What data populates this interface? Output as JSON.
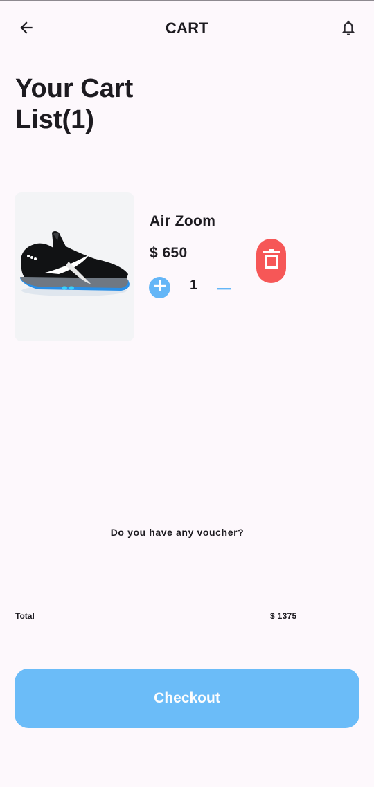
{
  "app_bar": {
    "title": "CART",
    "back_icon": "arrow-left-icon",
    "notification_icon": "bell-icon"
  },
  "page": {
    "title_line1": "Your Cart",
    "title_line2": "List(1)"
  },
  "cart": {
    "items": [
      {
        "name": "Air Zoom",
        "price": "$ 650",
        "quantity": "1",
        "image_icon": "sneaker-image",
        "add_icon": "plus-circle-icon",
        "remove_icon": "minus-icon",
        "delete_icon": "trash-icon"
      }
    ]
  },
  "voucher": {
    "label": "Do you have any voucher?"
  },
  "summary": {
    "total_label": "Total",
    "total_value": "$ 1375"
  },
  "checkout": {
    "label": "Checkout"
  },
  "colors": {
    "background": "#fdf8fc",
    "accent_blue": "#64b6f7",
    "checkout_blue": "#6bbcf8",
    "delete_red": "#f65757",
    "text": "#1d1b20"
  }
}
